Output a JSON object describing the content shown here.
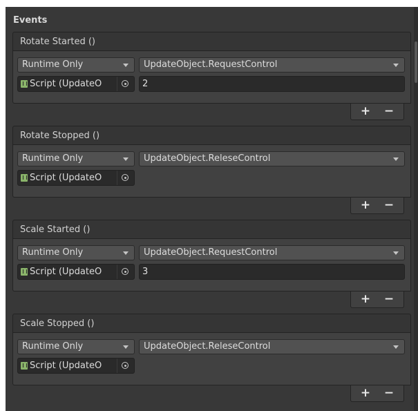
{
  "section_title": "Events",
  "events": [
    {
      "header": "Rotate Started ()",
      "mode": "Runtime Only",
      "function": "UpdateObject.RequestControl",
      "object": "Script (UpdateO",
      "argument": "2",
      "add_label": "+",
      "remove_label": "−"
    },
    {
      "header": "Rotate Stopped ()",
      "mode": "Runtime Only",
      "function": "UpdateObject.ReleseControl",
      "object": "Script (UpdateO",
      "add_label": "+",
      "remove_label": "−"
    },
    {
      "header": "Scale Started ()",
      "mode": "Runtime Only",
      "function": "UpdateObject.RequestControl",
      "object": "Script (UpdateO",
      "argument": "3",
      "add_label": "+",
      "remove_label": "−"
    },
    {
      "header": "Scale Stopped ()",
      "mode": "Runtime Only",
      "function": "UpdateObject.ReleseControl",
      "object": "Script (UpdateO",
      "add_label": "+",
      "remove_label": "−"
    }
  ]
}
